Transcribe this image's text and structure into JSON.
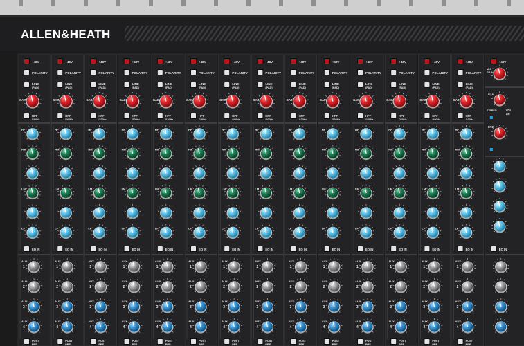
{
  "brand": {
    "name": "ALLEN&HEATH"
  },
  "mono_channel": {
    "phantom_label": "+48V",
    "polarity_label": "POLARITY",
    "line_label": "LINE",
    "line_sub": "(PAD)",
    "gain_label": "GAIN",
    "hpf_label": "HPF",
    "hpf_sub": "/100Hz",
    "eq_labels": [
      "HF",
      "HM",
      "",
      "LM",
      "",
      "LF"
    ],
    "eq_in_label": "EQ IN",
    "aux_labels": [
      "AUX 1",
      "AUX 2",
      "AUX 3",
      "AUX 4"
    ],
    "post_label": "POST",
    "pre_label": "PRE"
  },
  "stereo_channel": {
    "phantom_label": "+48V",
    "mic_gain_label": "MIC GAIN",
    "st1_label": "ST1",
    "st2_label": "ST2",
    "stereo_label": "STEREO",
    "ch_label": "CH1",
    "lr_label": "L/R",
    "eq_in_label": "EQ IN"
  },
  "channel_count": 14,
  "knob_colors": {
    "gain": "#d8252a",
    "hf": "#5fc4e8",
    "hm": "#1e7a52",
    "lm": "#1e7a52",
    "lf": "#5fc4e8",
    "aux_upper": "#9a9a9a",
    "aux_lower": "#3a95d3",
    "phantom_button": "#c0131a"
  }
}
